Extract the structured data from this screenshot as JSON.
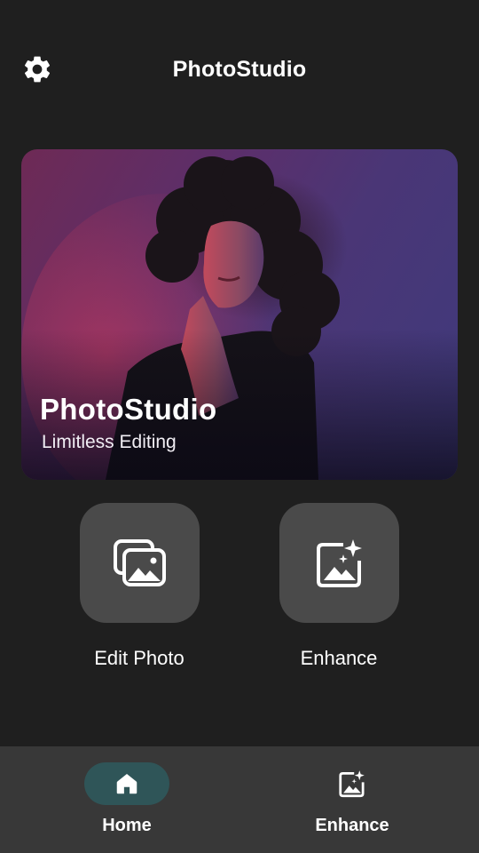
{
  "header": {
    "title": "PhotoStudio",
    "settings_icon": "gear-icon"
  },
  "hero": {
    "title": "PhotoStudio",
    "subtitle": "Limitless Editing",
    "image": "portrait-photo"
  },
  "actions": [
    {
      "label": "Edit Photo",
      "icon": "photo-library-icon"
    },
    {
      "label": "Enhance",
      "icon": "image-sparkle-icon"
    }
  ],
  "bottom_nav": {
    "items": [
      {
        "label": "Home",
        "icon": "home-icon",
        "active": true
      },
      {
        "label": "Enhance",
        "icon": "image-sparkle-icon",
        "active": false
      }
    ]
  },
  "colors": {
    "background": "#1f1f1f",
    "tile": "#4a4a4a",
    "nav_background": "#383838",
    "active_pill": "#2f5558",
    "text": "#ffffff"
  }
}
